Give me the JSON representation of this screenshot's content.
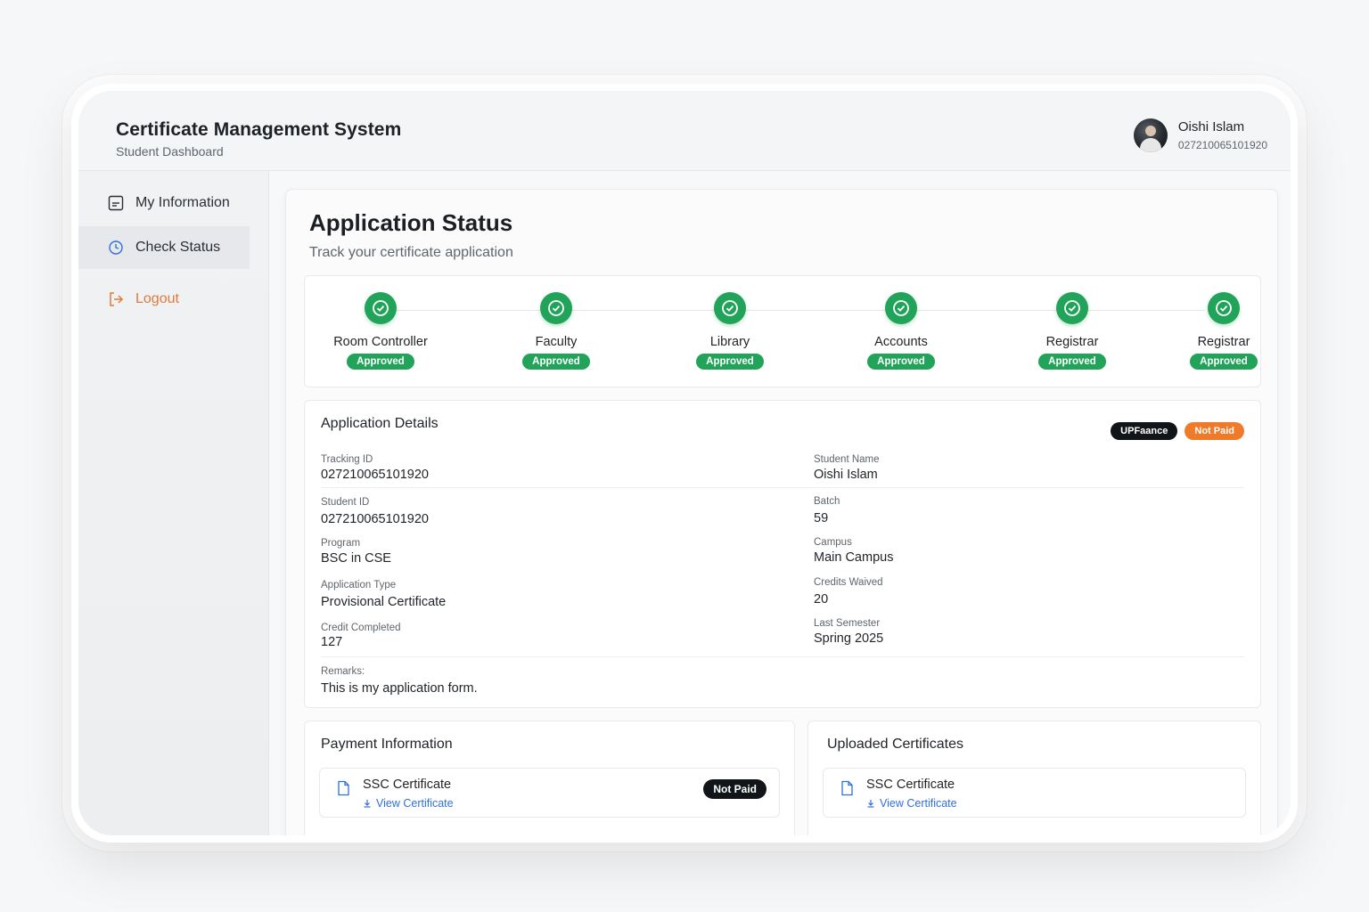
{
  "header": {
    "title": "Certificate Management System",
    "subtitle": "Student Dashboard",
    "user_name": "Oishi Islam",
    "user_id": "027210065101920"
  },
  "sidebar": {
    "items": [
      {
        "label": "My Information",
        "icon": "document-icon"
      },
      {
        "label": "Check Status",
        "icon": "clock-icon"
      },
      {
        "label": "Logout",
        "icon": "logout-icon"
      }
    ]
  },
  "main": {
    "title": "Application Status",
    "subtitle": "Track your certificate application"
  },
  "steps": [
    {
      "label": "Room Controller",
      "status": "Approved"
    },
    {
      "label": "Faculty",
      "status": "Approved"
    },
    {
      "label": "Library",
      "status": "Approved"
    },
    {
      "label": "Accounts",
      "status": "Approved"
    },
    {
      "label": "Registrar",
      "status": "Approved"
    },
    {
      "label": "Registrar",
      "status": "Approved"
    }
  ],
  "details": {
    "title": "Application Details",
    "badge_1": "UPFaance",
    "badge_2": "Not Paid",
    "tracking_id_label": "Tracking ID",
    "tracking_id": "027210065101920",
    "student_name_label": "Student Name",
    "student_name": "Oishi Islam",
    "student_id_label": "Student ID",
    "student_id": "027210065101920",
    "batch_label": "Batch",
    "batch": "59",
    "program_label": "Program",
    "program": "BSC in CSE",
    "campus_label": "Campus",
    "campus": "Main Campus",
    "app_type_label": "Application Type",
    "app_type": "Provisional Certificate",
    "credits_waived_label": "Credits Waived",
    "credits_waived": "20",
    "credit_completed_label": "Credit Completed",
    "credit_completed": "127",
    "last_semester_label": "Last Semester",
    "last_semester": "Spring 2025",
    "remarks_label": "Remarks:",
    "remarks": "This is my application form."
  },
  "payment": {
    "title": "Payment Information",
    "doc_name": "SSC Certificate",
    "doc_link": "View Certificate",
    "doc_status": "Not Paid"
  },
  "uploads": {
    "title": "Uploaded Certificates",
    "doc_name": "SSC Certificate",
    "doc_link": "View Certificate"
  },
  "colors": {
    "approved": "#21a35a",
    "not_paid_orange": "#ef7a2a",
    "dark_badge": "#111418",
    "link": "#2f6fdc",
    "logout": "#e07a3a"
  }
}
